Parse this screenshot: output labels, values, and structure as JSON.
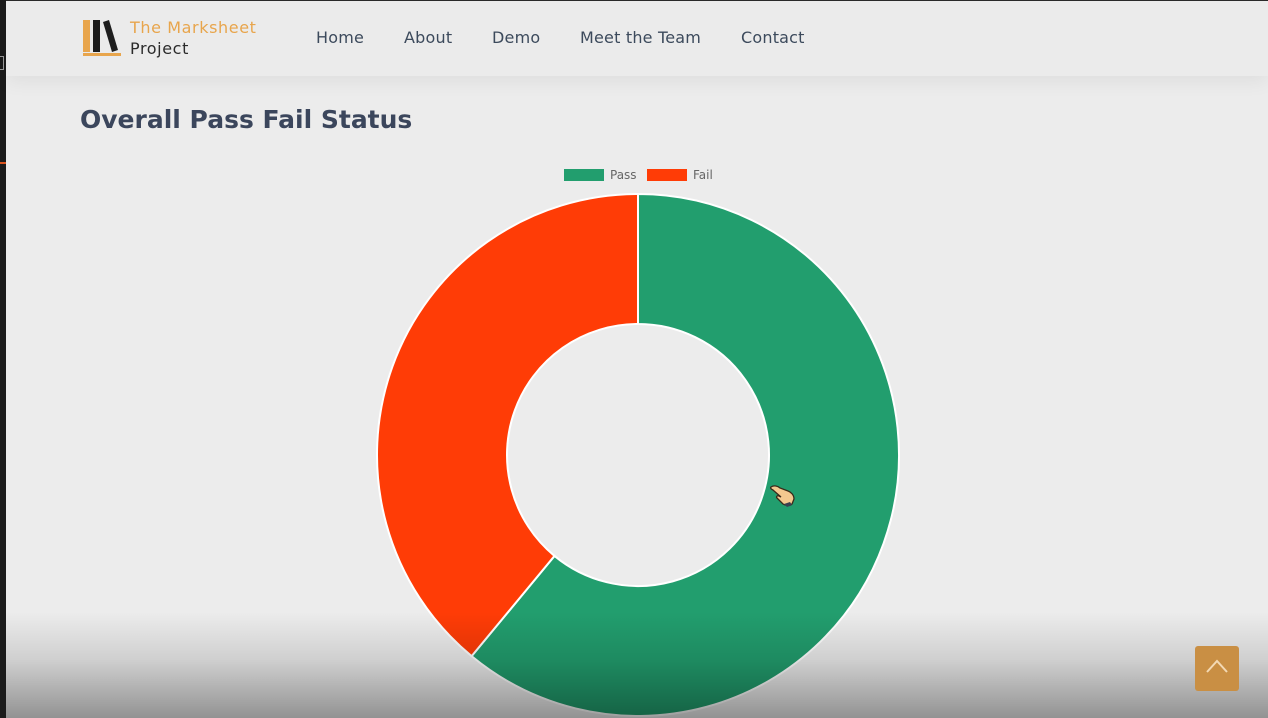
{
  "brand": {
    "line1": "The Marksheet",
    "line2": "Project",
    "icon": "books-icon"
  },
  "nav": {
    "items": [
      {
        "label": "Home"
      },
      {
        "label": "About"
      },
      {
        "label": "Demo"
      },
      {
        "label": "Meet the Team"
      },
      {
        "label": "Contact"
      }
    ]
  },
  "page": {
    "title": "Overall Pass Fail Status"
  },
  "chart_data": {
    "type": "pie",
    "variant": "doughnut",
    "legend_position": "top",
    "categories": [
      "Pass",
      "Fail"
    ],
    "values": [
      61,
      39
    ],
    "colors": [
      "#229e6e",
      "#ff3c06"
    ]
  },
  "controls": {
    "back_to_top_icon": "chevron-up-icon"
  },
  "colors": {
    "accent": "#e8a54c",
    "back_to_top": "#c98f44",
    "pass": "#229e6e",
    "fail": "#ff3c06"
  }
}
